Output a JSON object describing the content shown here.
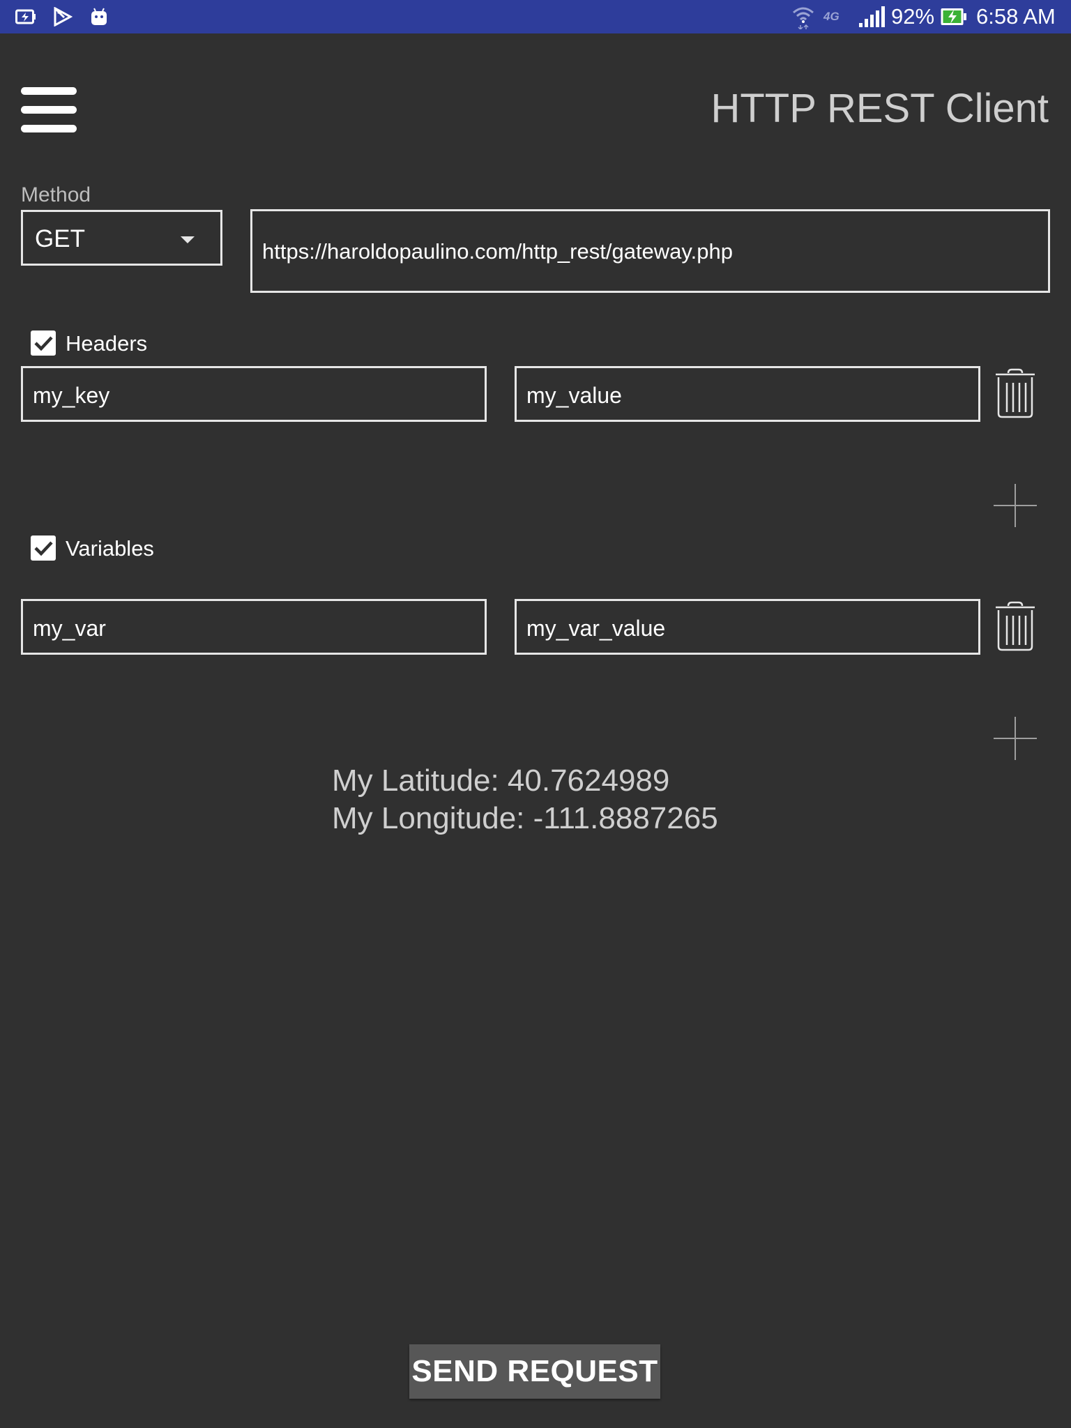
{
  "status_bar": {
    "left_icons": [
      "battery-saver-icon",
      "play-store-icon",
      "android-icon"
    ],
    "right_icons": [
      "wifi-icon",
      "lte-icon",
      "signal-icon",
      "battery-charging-icon"
    ],
    "network": "4G",
    "battery_percent": "92%",
    "time": "6:58 AM",
    "background_color": "#2e3d9b"
  },
  "header": {
    "menu_icon": "hamburger-menu-icon",
    "title": "HTTP REST Client"
  },
  "request": {
    "method_label": "Method",
    "method_value": "GET",
    "url": "https://haroldopaulino.com/http_rest/gateway.php"
  },
  "headers_section": {
    "checked": true,
    "label": "Headers",
    "rows": [
      {
        "key": "my_key",
        "value": "my_value"
      }
    ]
  },
  "variables_section": {
    "checked": true,
    "label": "Variables",
    "rows": [
      {
        "key": "my_var",
        "value": "my_var_value"
      }
    ]
  },
  "location": {
    "latitude": "My Latitude: 40.7624989",
    "longitude": "My Longitude: -111.8887265"
  },
  "actions": {
    "send_label": "SEND REQUEST"
  },
  "colors": {
    "background": "#303030",
    "border": "#e6e6e6",
    "button": "#575757"
  }
}
